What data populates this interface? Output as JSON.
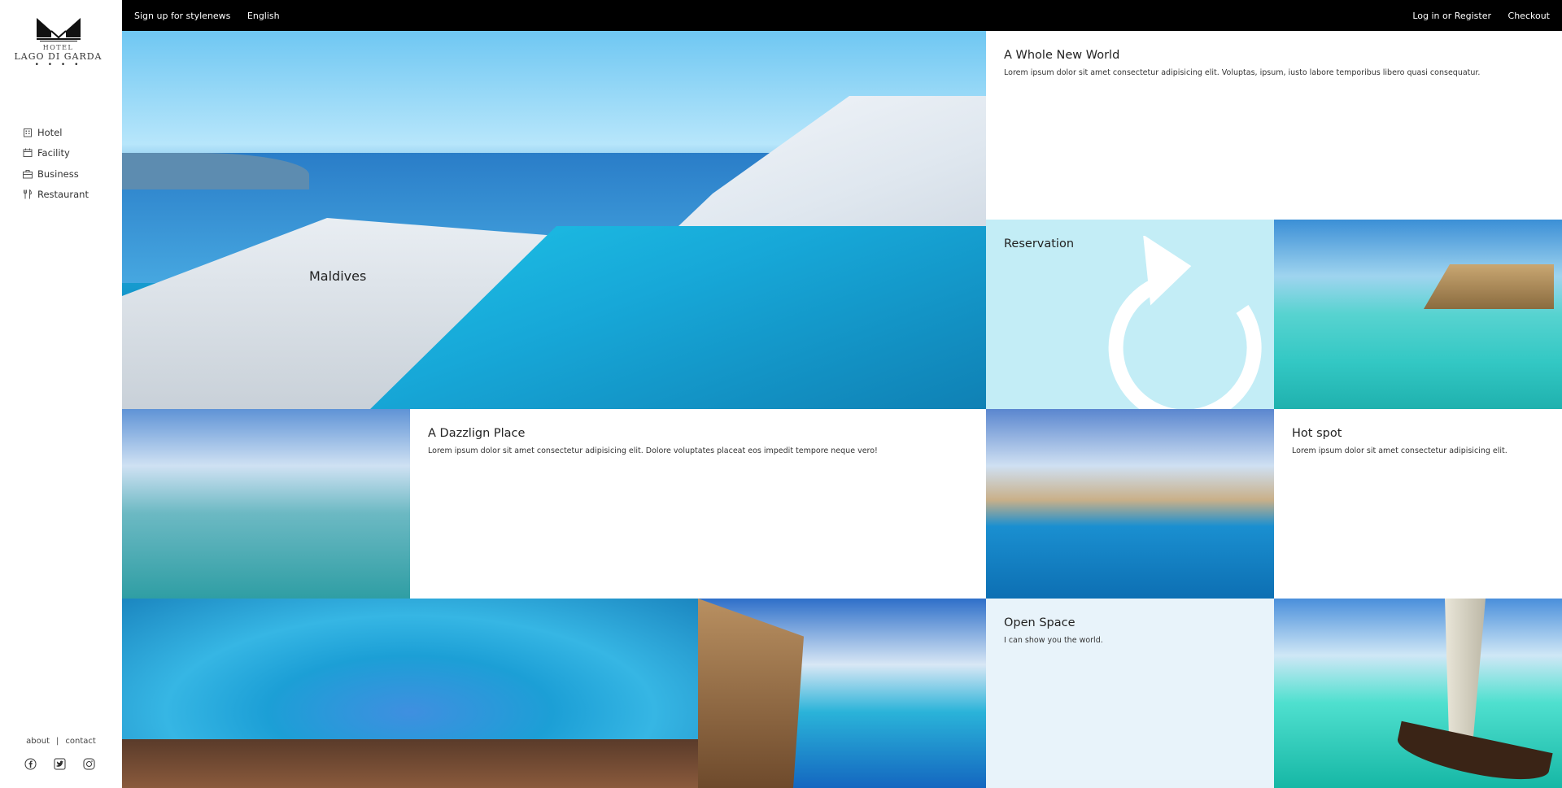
{
  "brand": {
    "line1": "HOTEL",
    "line2": "LAGO DI GARDA",
    "stars": "• • • •"
  },
  "nav": [
    {
      "label": "Hotel",
      "icon": "building-icon"
    },
    {
      "label": "Facility",
      "icon": "calendar-icon"
    },
    {
      "label": "Business",
      "icon": "briefcase-icon"
    },
    {
      "label": "Restaurant",
      "icon": "cutlery-icon"
    }
  ],
  "footer": {
    "about": "about",
    "separator": "|",
    "contact": "contact",
    "social": [
      "facebook-icon",
      "twitter-icon",
      "instagram-icon"
    ]
  },
  "topbar": {
    "signup": "Sign up for stylenews",
    "language": "English",
    "login": "Log in or Register",
    "checkout": "Checkout"
  },
  "hero": {
    "word": "Maldives"
  },
  "tiles": {
    "world": {
      "title": "A Whole New World",
      "text": "Lorem ipsum dolor sit amet consectetur adipisicing elit. Voluptas, ipsum, iusto labore temporibus libero quasi consequatur."
    },
    "reservation": {
      "title": "Reservation"
    },
    "dazzling": {
      "title": "A Dazzlign Place",
      "text": "Lorem ipsum dolor sit amet consectetur adipisicing elit. Dolore voluptates placeat eos impedit tempore neque vero!"
    },
    "hotspot": {
      "title": "Hot spot",
      "text": "Lorem ipsum dolor sit amet consectetur adipisicing elit."
    },
    "openspace": {
      "title": "Open Space",
      "text": "I can show you the world."
    }
  },
  "colors": {
    "topbar": "#000000",
    "reservation_bg": "#c3edf6",
    "openspace_bg": "#e8f3fa"
  }
}
